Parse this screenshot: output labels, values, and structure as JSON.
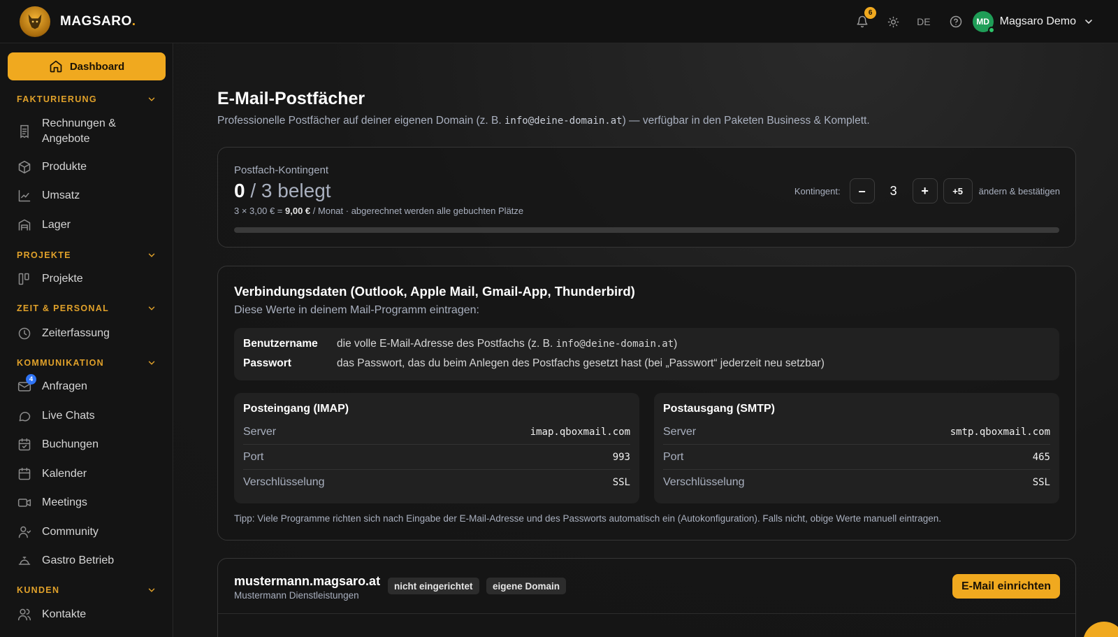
{
  "brand": {
    "name": "MAGSARO",
    "dot": "."
  },
  "topbar": {
    "notifications": "6",
    "language": "DE",
    "user_initials": "MD",
    "user_name": "Magsaro Demo"
  },
  "sidebar": {
    "dashboard": "Dashboard",
    "sections": {
      "fakturierung": "FAKTURIERUNG",
      "projekte": "PROJEKTE",
      "zeit": "ZEIT & PERSONAL",
      "kommunikation": "KOMMUNIKATION",
      "kunden": "KUNDEN"
    },
    "items": {
      "rechnungen_1": "Rechnungen &",
      "rechnungen_2": "Angebote",
      "produkte": "Produkte",
      "umsatz": "Umsatz",
      "lager": "Lager",
      "projekte": "Projekte",
      "zeiterfassung": "Zeiterfassung",
      "anfragen": "Anfragen",
      "anfragen_badge": "4",
      "live_chats": "Live Chats",
      "buchungen": "Buchungen",
      "kalender": "Kalender",
      "meetings": "Meetings",
      "community": "Community",
      "gastro": "Gastro Betrieb",
      "kontakte": "Kontakte"
    }
  },
  "page": {
    "title": "E-Mail-Postfächer",
    "subtitle_pre": "Professionelle Postfächer auf deiner eigenen Domain (z. B. ",
    "subtitle_example": "info@deine-domain.at",
    "subtitle_post": ") — verfügbar in den Paketen Business & Komplett."
  },
  "quota": {
    "label": "Postfach-Kontingent",
    "used": "0",
    "total_text": " / 3 belegt",
    "price_pre": "3 × 3,00 € = ",
    "price_total": "9,00 €",
    "price_post": " / Monat · abgerechnet werden alle gebuchten Plätze",
    "used_fraction": 0,
    "controls_label": "Kontingent:",
    "minus": "–",
    "value": "3",
    "plus": "+",
    "plus5": "+5",
    "confirm": "ändern & bestätigen"
  },
  "connection": {
    "title": "Verbindungsdaten (Outlook, Apple Mail, Gmail-App, Thunderbird)",
    "subtitle": "Diese Werte in deinem Mail-Programm eintragen:",
    "username_label": "Benutzername",
    "username_pre": "die volle E-Mail-Adresse des Postfachs (z. B. ",
    "username_example": "info@deine-domain.at",
    "username_post": ")",
    "password_label": "Passwort",
    "password_value": "das Passwort, das du beim Anlegen des Postfachs gesetzt hast (bei „Passwort“ jederzeit neu setzbar)",
    "imap": {
      "title": "Posteingang (IMAP)",
      "server_label": "Server",
      "server": "imap.qboxmail.com",
      "port_label": "Port",
      "port": "993",
      "enc_label": "Verschlüsselung",
      "enc": "SSL"
    },
    "smtp": {
      "title": "Postausgang (SMTP)",
      "server_label": "Server",
      "server": "smtp.qboxmail.com",
      "port_label": "Port",
      "port": "465",
      "enc_label": "Verschlüsselung",
      "enc": "SSL"
    },
    "tip": "Tipp: Viele Programme richten sich nach Eingabe der E-Mail-Adresse und des Passworts automatisch ein (Autokonfiguration). Falls nicht, obige Werte manuell eintragen."
  },
  "domain": {
    "name": "mustermann.magsaro.at",
    "company": "Mustermann Dienstleistungen",
    "tag_status": "nicht eingerichtet",
    "tag_type": "eigene Domain",
    "setup_button": "E-Mail einrichten"
  },
  "colors": {
    "accent": "#f0a91f",
    "background": "#141414",
    "badge_blue": "#2f74f5",
    "avatar_green": "#1f9d57"
  }
}
